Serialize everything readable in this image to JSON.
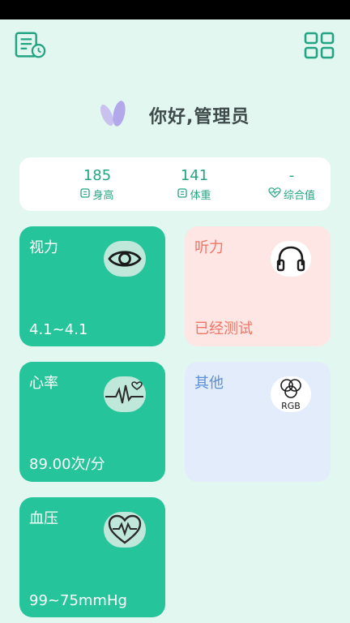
{
  "greeting": "你好,管理员",
  "stats": {
    "height": {
      "value": "185",
      "label": "身高"
    },
    "weight": {
      "value": "141",
      "label": "体重"
    },
    "overall": {
      "value": "-",
      "label": "综合值"
    }
  },
  "cards": {
    "vision": {
      "title": "视力",
      "value": "4.1~4.1"
    },
    "hearing": {
      "title": "听力",
      "value": "已经测试"
    },
    "heartrate": {
      "title": "心率",
      "value": "89.00次/分"
    },
    "other": {
      "title": "其他",
      "icon_text": "RGB"
    },
    "bp": {
      "title": "血压",
      "value": "99~75mmHg"
    }
  },
  "colors": {
    "accent": "#26c49a",
    "background": "#e3f7f1",
    "hearing": "#f07566",
    "other": "#5a8fd6"
  }
}
